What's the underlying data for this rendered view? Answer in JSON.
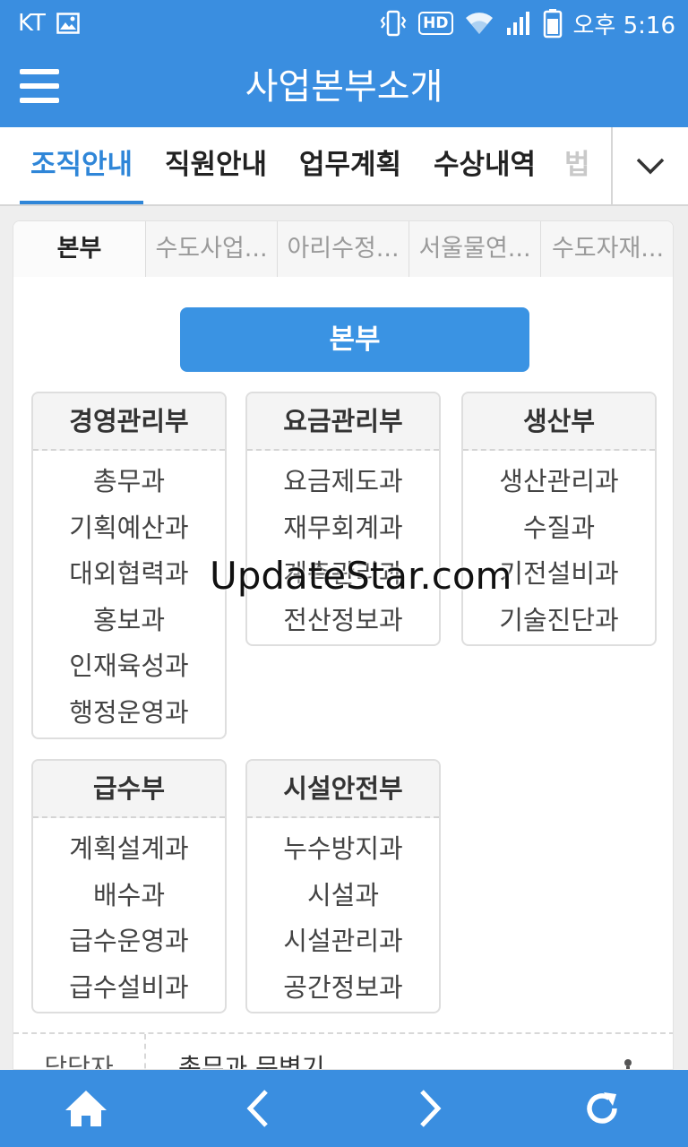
{
  "status_bar": {
    "carrier": "KT",
    "time": "오후 5:16",
    "hd_label": "HD"
  },
  "app_bar": {
    "title": "사업본부소개"
  },
  "tabs": [
    {
      "label": "조직안내",
      "active": true
    },
    {
      "label": "직원안내",
      "active": false
    },
    {
      "label": "업무계획",
      "active": false
    },
    {
      "label": "수상내역",
      "active": false
    },
    {
      "label": "법",
      "active": false
    }
  ],
  "sub_tabs": [
    {
      "label": "본부",
      "active": true
    },
    {
      "label": "수도사업...",
      "active": false
    },
    {
      "label": "아리수정...",
      "active": false
    },
    {
      "label": "서울물연...",
      "active": false
    },
    {
      "label": "수도자재...",
      "active": false
    }
  ],
  "headquarters_button": "본부",
  "departments": [
    {
      "name": "경영관리부",
      "sections": [
        "총무과",
        "기획예산과",
        "대외협력과",
        "홍보과",
        "인재육성과",
        "행정운영과"
      ]
    },
    {
      "name": "요금관리부",
      "sections": [
        "요금제도과",
        "재무회계과",
        "계측관리과",
        "전산정보과"
      ]
    },
    {
      "name": "생산부",
      "sections": [
        "생산관리과",
        "수질과",
        "기전설비과",
        "기술진단과"
      ]
    },
    {
      "name": "급수부",
      "sections": [
        "계획설계과",
        "배수과",
        "급수운영과",
        "급수설비과"
      ]
    },
    {
      "name": "시설안전부",
      "sections": [
        "누수방지과",
        "시설과",
        "시설관리과",
        "공간정보과"
      ]
    }
  ],
  "contact": {
    "label": "담당자",
    "value": "총무과 문병기"
  },
  "watermark": "UpdateStar.com"
}
